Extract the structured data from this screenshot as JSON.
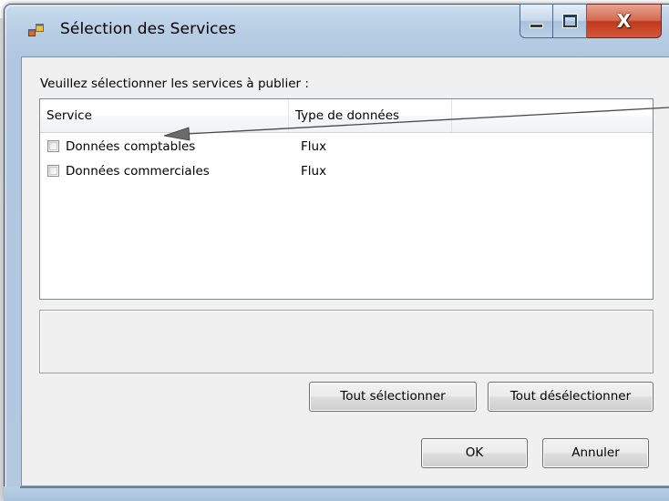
{
  "window": {
    "title": "Sélection des Services",
    "close_glyph": "X"
  },
  "prompt": "Veuillez sélectionner les services à publier :",
  "list": {
    "columns": [
      "Service",
      "Type de données"
    ],
    "rows": [
      {
        "checked": false,
        "service": "Données comptables",
        "type": "Flux"
      },
      {
        "checked": false,
        "service": "Données commerciales",
        "type": "Flux"
      }
    ]
  },
  "buttons": {
    "select_all": "Tout sélectionner",
    "deselect_all": "Tout désélectionner",
    "ok": "OK",
    "cancel": "Annuler"
  },
  "icons": {
    "window_icon": "application-window-icon",
    "minimize": "minimize-icon",
    "maximize": "maximize-icon",
    "close": "close-icon"
  },
  "colors": {
    "close_button": "#c8442a",
    "frame": "#b7cde4",
    "client_bg": "#f0f0f0"
  }
}
